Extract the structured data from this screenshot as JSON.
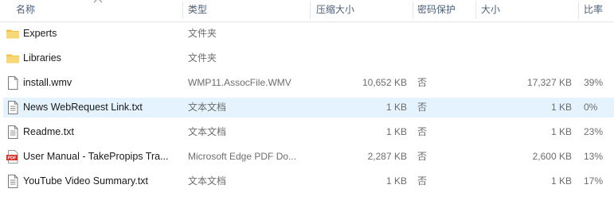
{
  "columns": {
    "name": "名称",
    "type": "类型",
    "compressed_size": "压缩大小",
    "password": "密码保护",
    "size": "大小",
    "ratio": "比率"
  },
  "rows": [
    {
      "name": "Experts",
      "type": "文件夹",
      "compressed_size": "",
      "password": "",
      "size": "",
      "ratio": "",
      "icon": "folder-icon"
    },
    {
      "name": "Libraries",
      "type": "文件夹",
      "compressed_size": "",
      "password": "",
      "size": "",
      "ratio": "",
      "icon": "folder-icon"
    },
    {
      "name": "install.wmv",
      "type": "WMP11.AssocFile.WMV",
      "compressed_size": "10,652 KB",
      "password": "否",
      "size": "17,327 KB",
      "ratio": "39%",
      "icon": "file-icon"
    },
    {
      "name": "News WebRequest Link.txt",
      "type": "文本文档",
      "compressed_size": "1 KB",
      "password": "否",
      "size": "1 KB",
      "ratio": "0%",
      "icon": "text-file-icon"
    },
    {
      "name": "Readme.txt",
      "type": "文本文档",
      "compressed_size": "1 KB",
      "password": "否",
      "size": "1 KB",
      "ratio": "23%",
      "icon": "text-file-icon"
    },
    {
      "name": "User Manual - TakePropips Tra...",
      "type": "Microsoft Edge PDF Do...",
      "compressed_size": "2,287 KB",
      "password": "否",
      "size": "2,600 KB",
      "ratio": "13%",
      "icon": "pdf-icon"
    },
    {
      "name": "YouTube Video Summary.txt",
      "type": "文本文档",
      "compressed_size": "1 KB",
      "password": "否",
      "size": "1 KB",
      "ratio": "17%",
      "icon": "text-file-icon"
    }
  ],
  "selected_row": 3,
  "pdf_label": "PDF",
  "colors": {
    "selected": "#e5f3ff",
    "folder": "#f8d775",
    "pdf": "#d42a1e"
  }
}
